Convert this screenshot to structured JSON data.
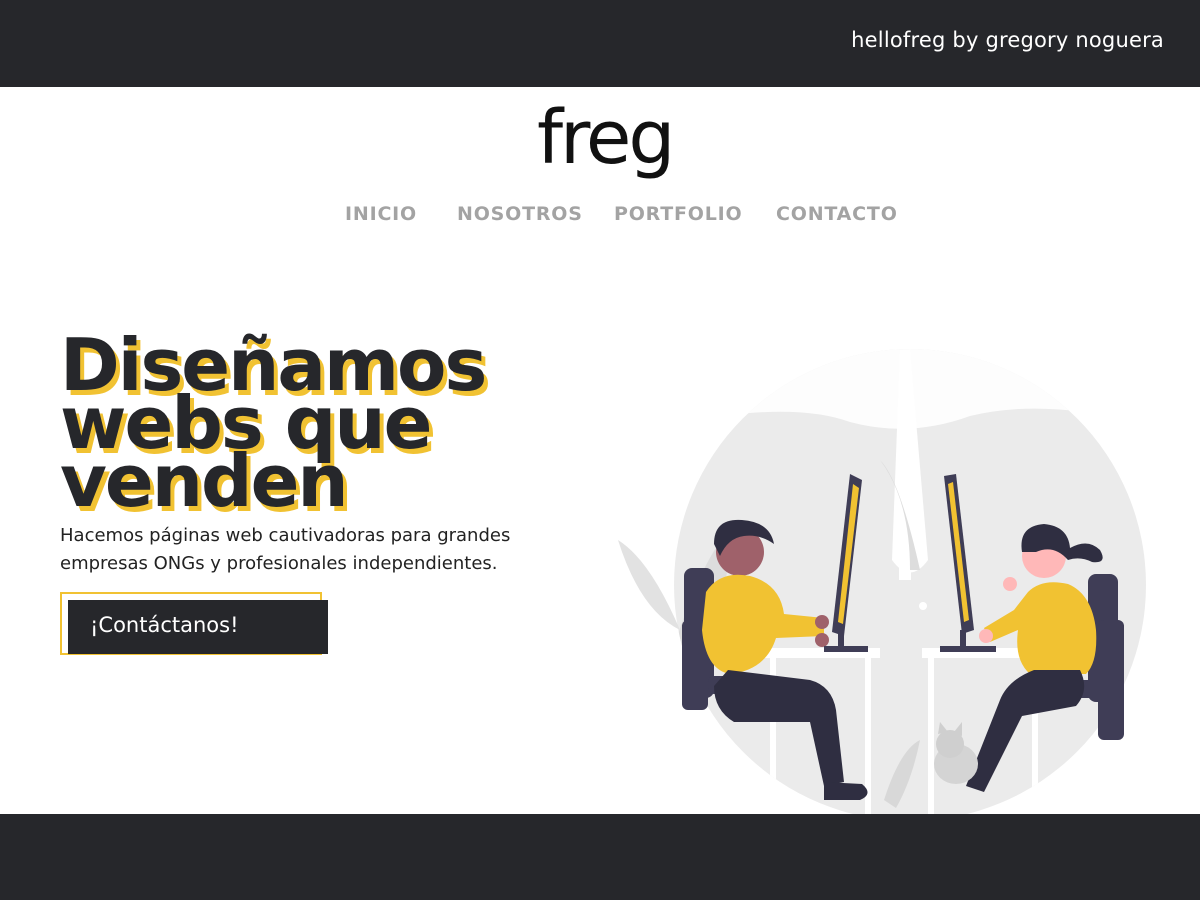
{
  "topbar": {
    "credit": "hellofreg by gregory noguera"
  },
  "logo": {
    "text": "freg"
  },
  "nav": {
    "items": [
      {
        "label": "INICIO"
      },
      {
        "label": "NOSOTROS"
      },
      {
        "label": "PORTFOLIO"
      },
      {
        "label": "CONTACTO"
      }
    ]
  },
  "hero": {
    "headline_lines": [
      "Diseñamos",
      "webs que",
      "venden"
    ],
    "subtitle": "Hacemos páginas web cautivadoras para grandes empresas ONGs y profesionales independientes.",
    "cta_label": "¡Contáctanos!"
  },
  "colors": {
    "dark": "#26272b",
    "accent_yellow": "#f1c232",
    "nav_gray": "#a3a3a3",
    "illustration_gray": "#ebebeb",
    "illustration_purple": "#3f3d56"
  },
  "icons": {
    "illustration": "two-people-working-at-computers-illustration"
  }
}
